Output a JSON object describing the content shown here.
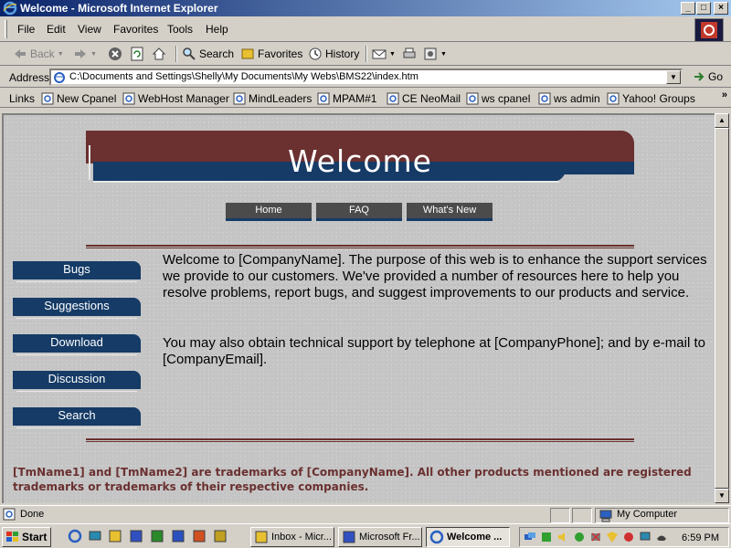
{
  "window": {
    "title": "Welcome - Microsoft Internet Explorer",
    "min_label": "_",
    "max_label": "□",
    "close_label": "×"
  },
  "menu": [
    "File",
    "Edit",
    "View",
    "Favorites",
    "Tools",
    "Help"
  ],
  "toolbar": {
    "back": "Back",
    "search": "Search",
    "favorites": "Favorites",
    "history": "History"
  },
  "address": {
    "label": "Address",
    "value": "C:\\Documents and Settings\\Shelly\\My Documents\\My Webs\\BMS22\\index.htm",
    "go": "Go"
  },
  "links": {
    "label": "Links",
    "more": "»",
    "items": [
      "New Cpanel",
      "WebHost Manager",
      "MindLeaders",
      "MPAM#1",
      "CE NeoMail",
      "ws cpanel",
      "ws admin",
      "Yahoo! Groups"
    ]
  },
  "page": {
    "banner_title": "Welcome",
    "nav": [
      "Home",
      "FAQ",
      "What's New"
    ],
    "sidebar": [
      "Bugs",
      "Suggestions",
      "Download",
      "Discussion",
      "Search"
    ],
    "paragraph1": "Welcome to [CompanyName]. The purpose of this web is to enhance the support services we provide to our customers. We've provided a number of resources here to help you resolve problems, report bugs, and suggest improvements to our products and service.",
    "paragraph2": "You may also obtain technical support by telephone at [CompanyPhone]; and by e-mail to [CompanyEmail].",
    "footer": "[TmName1] and [TmName2] are trademarks of [CompanyName]. All other products mentioned are registered trademarks or trademarks of their respective companies."
  },
  "status": {
    "text": "Done",
    "zone": "My Computer"
  },
  "taskbar": {
    "start": "Start",
    "tasks": [
      "Inbox - Micr...",
      "Microsoft Fr...",
      "Welcome ..."
    ],
    "clock": "6:59 PM"
  },
  "colors": {
    "banner_maroon": "#6b3030",
    "banner_navy": "#153b66",
    "footer_text": "#6b3030",
    "titlebar_start": "#0a246a"
  }
}
